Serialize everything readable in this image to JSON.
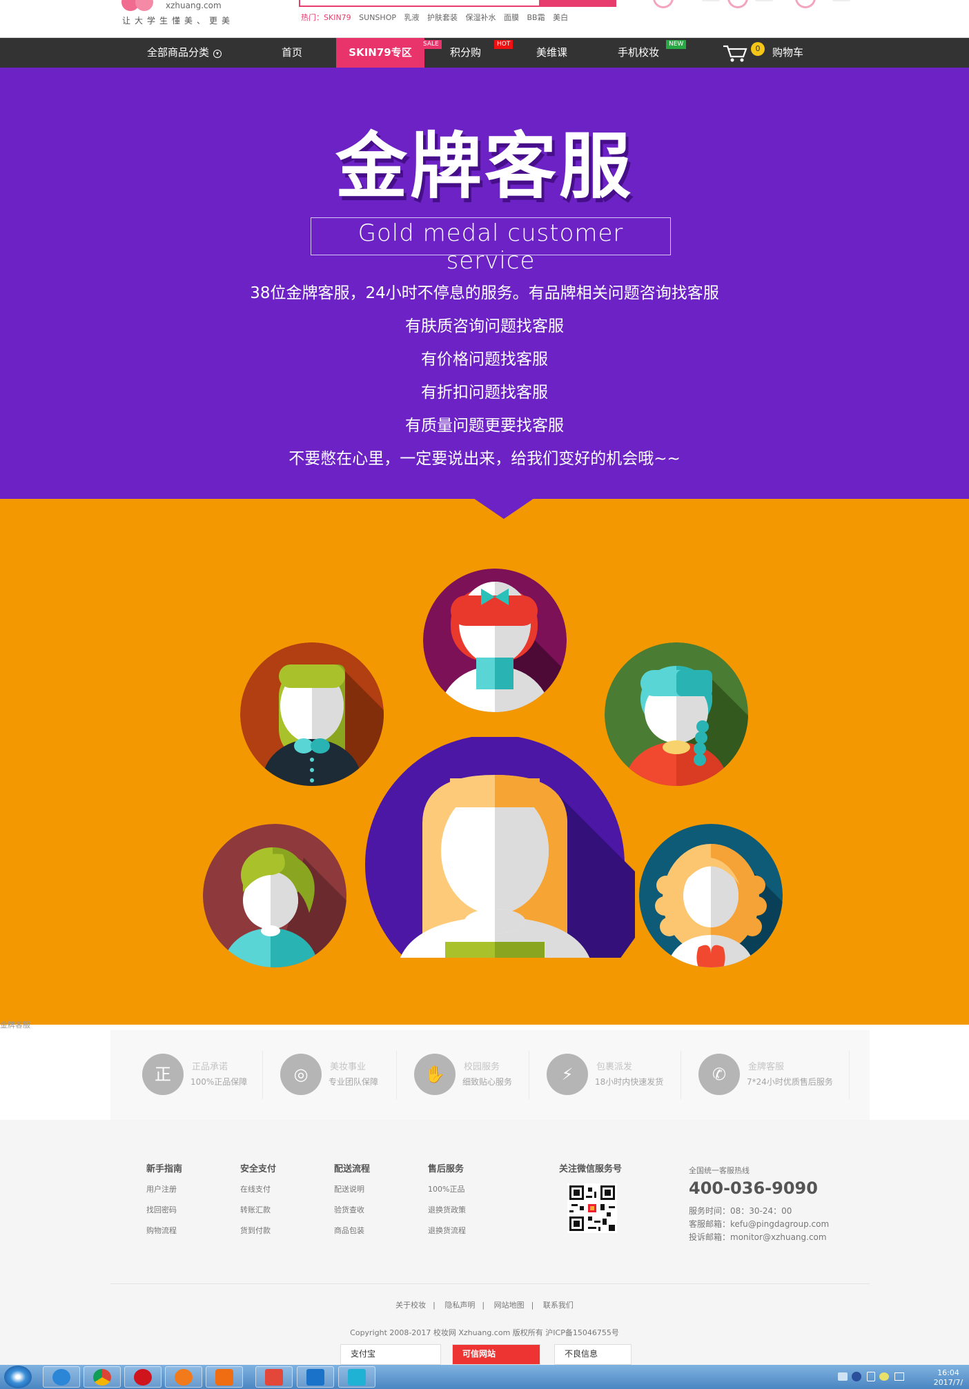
{
  "header": {
    "logo_domain": "xzhuang.com",
    "slogan": "让大学生懂美、更美",
    "hot_words": [
      "热门：SKIN79",
      "SUNSHOP",
      "乳液",
      "护肤套装",
      "保湿补水",
      "面膜",
      "BB霜",
      "美白"
    ]
  },
  "nav": {
    "categories": "全部商品分类",
    "home": "首页",
    "skin79": "SKIN79专区",
    "sale_badge": "SALE",
    "points": "积分购",
    "hot_badge": "HOT",
    "beauty_class": "美维课",
    "mobile": "手机校妆",
    "new_badge": "NEW",
    "cart_count": "0",
    "cart": "购物车"
  },
  "hero": {
    "title": "金牌客服",
    "subtitle": "Gold medal customer service",
    "lines": [
      "38位金牌客服，24小时不停息的服务。有品牌相关问题咨询找客服",
      "有肤质咨询问题找客服",
      "有价格问题找客服",
      "有折扣问题找客服",
      "有质量问题更要找客服",
      "不要憋在心里，一定要说出来，给我们变好的机会哦~~"
    ]
  },
  "caption": "金牌客服",
  "services": [
    {
      "icon": "正",
      "title": "正品承诺",
      "desc": "100%正品保障"
    },
    {
      "icon": "◎",
      "title": "美妆事业",
      "desc": "专业团队保障"
    },
    {
      "icon": "✋",
      "title": "校园服务",
      "desc": "细致贴心服务"
    },
    {
      "icon": "⚡",
      "title": "包裹派发",
      "desc": "18小时内快速发货"
    },
    {
      "icon": "✆",
      "title": "金牌客服",
      "desc": "7*24小时优质售后服务"
    }
  ],
  "footer": {
    "columns": [
      {
        "title": "新手指南",
        "links": [
          "用户注册",
          "找回密码",
          "购物流程"
        ]
      },
      {
        "title": "安全支付",
        "links": [
          "在线支付",
          "转账汇款",
          "货到付款"
        ]
      },
      {
        "title": "配送流程",
        "links": [
          "配送说明",
          "验货查收",
          "商品包装"
        ]
      },
      {
        "title": "售后服务",
        "links": [
          "100%正品",
          "退换货政策",
          "退换货流程"
        ]
      }
    ],
    "qr_title": "关注微信服务号",
    "hotline_label": "全国统一客服热线",
    "hotline": "400-036-9090",
    "service_time": "服务时间：08：30-24：00",
    "service_email": "客服邮箱：kefu@pingdagroup.com",
    "complaint_email": "投诉邮箱：monitor@xzhuang.com",
    "bottom_links": [
      "关于校妆",
      "隐私声明",
      "网站地图",
      "联系我们"
    ],
    "copyright": "Copyright 2008-2017 校妆网 Xzhuang.com 版权所有 沪ICP备15046755号",
    "trust": [
      "支付宝",
      "可信网站",
      "不良信息"
    ]
  },
  "taskbar": {
    "time": "16:04",
    "date": "2017/7/"
  },
  "colors": {
    "hero_purple": "#6c22c4",
    "orange": "#f39800",
    "accent_pink": "#e8336b",
    "nav_dark": "#333333"
  }
}
